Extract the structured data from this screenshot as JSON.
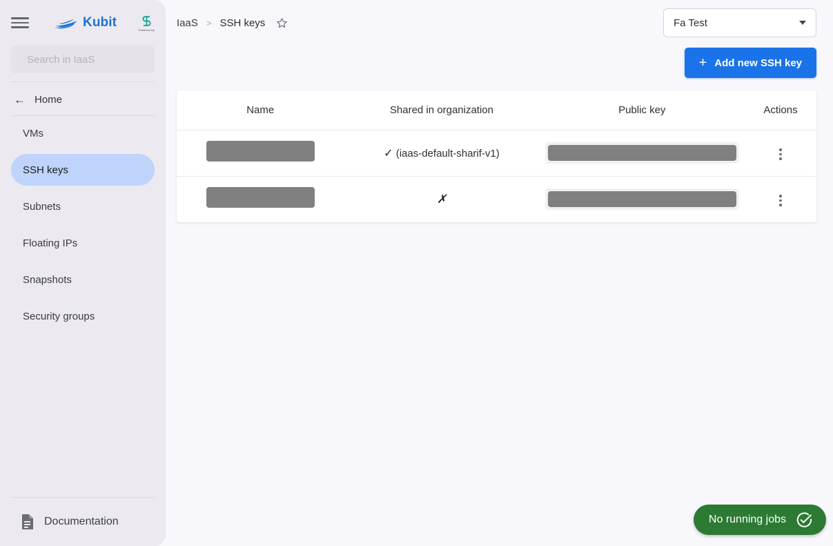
{
  "sidebar": {
    "menu_icon": "hamburger-icon",
    "brand": {
      "name": "Kubit",
      "logo_icon": "kubit-boat-logo",
      "color": "#1d72d6"
    },
    "partner_logo": {
      "icon": "partner-s-logo",
      "caption": "Powered by",
      "color": "#18a497"
    },
    "search": {
      "placeholder": "Search in IaaS",
      "value": "",
      "icon": "search-icon"
    },
    "home": {
      "label": "Home",
      "icon": "arrow-left-icon"
    },
    "items": [
      {
        "label": "VMs",
        "active": false
      },
      {
        "label": "SSH keys",
        "active": true
      },
      {
        "label": "Subnets",
        "active": false
      },
      {
        "label": "Floating IPs",
        "active": false
      },
      {
        "label": "Snapshots",
        "active": false
      },
      {
        "label": "Security groups",
        "active": false
      }
    ],
    "active_color": "#bed4fb",
    "documentation": {
      "label": "Documentation",
      "icon": "document-icon"
    }
  },
  "header": {
    "breadcrumb": {
      "root": "IaaS",
      "separator": ">",
      "current": "SSH keys"
    },
    "favorite_icon": "star-outline-icon",
    "org_select": {
      "value": "Fa Test",
      "caret_icon": "chevron-down-icon"
    }
  },
  "toolbar": {
    "add_button": {
      "label": "Add new SSH key",
      "icon": "plus-icon",
      "color": "#1a73e8"
    }
  },
  "table": {
    "columns": [
      "Name",
      "Shared in organization",
      "Public key",
      "Actions"
    ],
    "rows": [
      {
        "name": "",
        "name_redacted": true,
        "shared_mark": "✓",
        "shared_text": "(iaas-default-sharif-v1)",
        "public_key": "",
        "public_key_redacted": true,
        "actions_icon": "kebab-menu-icon"
      },
      {
        "name": "",
        "name_redacted": true,
        "shared_mark": "✗",
        "shared_text": "",
        "public_key": "",
        "public_key_redacted": true,
        "actions_icon": "kebab-menu-icon"
      }
    ]
  },
  "status": {
    "jobs_pill": {
      "label": "No running jobs",
      "icon": "check-circle-icon",
      "color": "#2c7a33"
    }
  }
}
